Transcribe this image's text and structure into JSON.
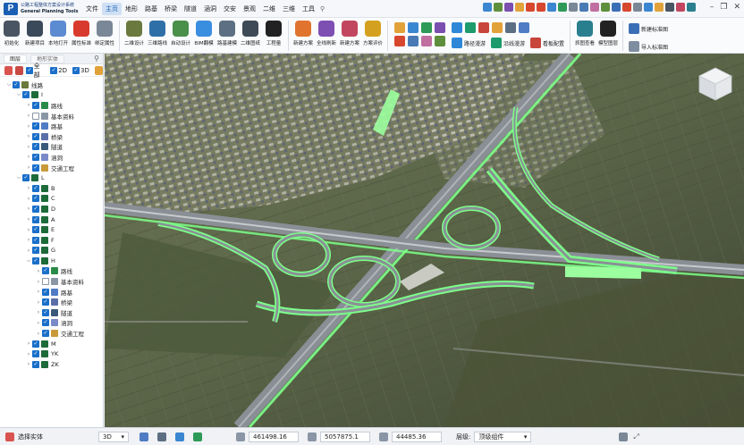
{
  "app": {
    "logo_mark": "P",
    "title_cn": "公路工程整体方案设计系统",
    "title_en": "General Planning Tools"
  },
  "menu": [
    "文件",
    "主页",
    "地形",
    "路基",
    "桥梁",
    "隧道",
    "涵洞",
    "交安",
    "景观",
    "二维",
    "三维",
    "工具"
  ],
  "menu_active": "主页",
  "pin_icon": "pin-icon",
  "ribbon": {
    "home": [
      {
        "label": "初始化",
        "icon": "gear-icon",
        "color": "#4a5563"
      },
      {
        "label": "新建项目",
        "icon": "road-icon",
        "color": "#3b4a5a"
      },
      {
        "label": "本地打开",
        "icon": "folder-open-icon",
        "color": "#5b8bd0"
      },
      {
        "label": "属性标准",
        "icon": "flag-icon",
        "color": "#d83a2e"
      },
      {
        "label": "绑定属性",
        "icon": "link-icon",
        "color": "#7a8797"
      }
    ],
    "design": [
      {
        "label": "二维设计",
        "icon": "route-icon",
        "color": "#6a7a3e"
      },
      {
        "label": "三维路线",
        "icon": "curve-icon",
        "color": "#2f6fa8"
      },
      {
        "label": "自动设计",
        "icon": "auto-icon",
        "color": "#4a8f4a"
      },
      {
        "label": "BIM翻模",
        "icon": "bim-icon",
        "color": "#3a8ee0"
      },
      {
        "label": "路基建模",
        "icon": "embankment-icon",
        "color": "#5d6f82"
      },
      {
        "label": "二维图纸",
        "icon": "drawing-icon",
        "color": "#3e4a56"
      },
      {
        "label": "工程量",
        "icon": "toggle-icon",
        "color": "#222222"
      }
    ],
    "scheme": [
      {
        "label": "新建方案",
        "icon": "new-scheme-icon",
        "color": "#e0742e"
      },
      {
        "label": "全线刷新",
        "icon": "refresh-icon",
        "color": "#7d4fb3"
      },
      {
        "label": "新建方案",
        "icon": "palette-icon",
        "color": "#c2465f"
      },
      {
        "label": "方案评价",
        "icon": "evaluate-icon",
        "color": "#d4a01f"
      }
    ],
    "tools_small": [
      "#e2a23a",
      "#3b86d1",
      "#2e9a57",
      "#7a4fb0",
      "#d7472e",
      "#4a7ab5",
      "#c06fa0",
      "#5d8f3c"
    ],
    "mid_labels": [
      {
        "label": "路径漫游",
        "color": "#2f87d8"
      },
      {
        "label": "沿线漫游",
        "color": "#1d9b6c"
      },
      {
        "label": "看板配置",
        "color": "#c7453a"
      }
    ],
    "view_buttons": [
      {
        "label": "抓图查看",
        "icon": "eye-icon",
        "color": "#2a7f8f"
      },
      {
        "label": "模型图层",
        "icon": "toggle-icon",
        "color": "#222222"
      }
    ],
    "std_labels": [
      {
        "label": "新建标准图",
        "color": "#3b6fb5"
      },
      {
        "label": "导入标准图",
        "color": "#7f8da0"
      }
    ]
  },
  "panel": {
    "tabs": [
      "图层",
      "地形实体"
    ],
    "checks": [
      {
        "label": "全部",
        "checked": true
      },
      {
        "label": "2D",
        "checked": true
      },
      {
        "label": "3D",
        "checked": true
      }
    ],
    "tree": [
      {
        "depth": 0,
        "toggle": "⌵",
        "label": "线路",
        "checked": true,
        "icon": "#6b7a3a"
      },
      {
        "depth": 1,
        "toggle": "⌵",
        "label": "I",
        "checked": true,
        "icon": "#1e6b3a"
      },
      {
        "depth": 2,
        "toggle": "›",
        "label": "路线",
        "checked": true,
        "icon": "#2a8a48"
      },
      {
        "depth": 2,
        "toggle": "›",
        "label": "基本资料",
        "checked": false,
        "icon": "#8a96a5"
      },
      {
        "depth": 2,
        "toggle": "›",
        "label": "路基",
        "checked": true,
        "icon": "#4f7cc4"
      },
      {
        "depth": 2,
        "toggle": "›",
        "label": "桥梁",
        "checked": true,
        "icon": "#5a6fa8"
      },
      {
        "depth": 2,
        "toggle": "›",
        "label": "隧道",
        "checked": true,
        "icon": "#3b5a7a"
      },
      {
        "depth": 2,
        "toggle": "›",
        "label": "涵洞",
        "checked": true,
        "icon": "#7a89c8"
      },
      {
        "depth": 2,
        "toggle": "›",
        "label": "交通工程",
        "checked": true,
        "icon": "#c89a3a"
      },
      {
        "depth": 1,
        "toggle": "⌵",
        "label": "L",
        "checked": true,
        "icon": "#1e6b3a"
      },
      {
        "depth": 2,
        "toggle": "›",
        "label": "B",
        "checked": true,
        "icon": "#1e6b3a"
      },
      {
        "depth": 2,
        "toggle": "›",
        "label": "C",
        "checked": true,
        "icon": "#1e6b3a"
      },
      {
        "depth": 2,
        "toggle": "›",
        "label": "D",
        "checked": true,
        "icon": "#1e6b3a"
      },
      {
        "depth": 2,
        "toggle": "›",
        "label": "A",
        "checked": true,
        "icon": "#1e6b3a"
      },
      {
        "depth": 2,
        "toggle": "›",
        "label": "E",
        "checked": true,
        "icon": "#1e6b3a"
      },
      {
        "depth": 2,
        "toggle": "›",
        "label": "F",
        "checked": true,
        "icon": "#1e6b3a"
      },
      {
        "depth": 2,
        "toggle": "›",
        "label": "G",
        "checked": true,
        "icon": "#1e6b3a"
      },
      {
        "depth": 2,
        "toggle": "⌵",
        "label": "H",
        "checked": true,
        "icon": "#1e6b3a"
      },
      {
        "depth": 3,
        "toggle": "›",
        "label": "路线",
        "checked": true,
        "icon": "#2a8a48"
      },
      {
        "depth": 3,
        "toggle": "›",
        "label": "基本资料",
        "checked": false,
        "icon": "#8a96a5"
      },
      {
        "depth": 3,
        "toggle": "›",
        "label": "路基",
        "checked": true,
        "icon": "#4f7cc4"
      },
      {
        "depth": 3,
        "toggle": "›",
        "label": "桥梁",
        "checked": true,
        "icon": "#5a6fa8"
      },
      {
        "depth": 3,
        "toggle": "›",
        "label": "隧道",
        "checked": true,
        "icon": "#3b5a7a"
      },
      {
        "depth": 3,
        "toggle": "›",
        "label": "涵洞",
        "checked": true,
        "icon": "#7a89c8"
      },
      {
        "depth": 3,
        "toggle": "›",
        "label": "交通工程",
        "checked": true,
        "icon": "#c89a3a"
      },
      {
        "depth": 2,
        "toggle": "›",
        "label": "M",
        "checked": true,
        "icon": "#1e6b3a"
      },
      {
        "depth": 2,
        "toggle": "›",
        "label": "YK",
        "checked": true,
        "icon": "#1e6b3a"
      },
      {
        "depth": 2,
        "toggle": "›",
        "label": "ZK",
        "checked": true,
        "icon": "#1e6b3a"
      }
    ]
  },
  "status": {
    "select_label": "选择实体",
    "view_mode": "3D",
    "x": "461498.16",
    "y": "5057875.1",
    "z": "44485.36",
    "level_label": "层级:",
    "level_value": "顶级组件"
  },
  "colors": {
    "accent": "#1a5fb4",
    "road_green": "#7dff8a",
    "road_gray": "#8a8f96"
  }
}
